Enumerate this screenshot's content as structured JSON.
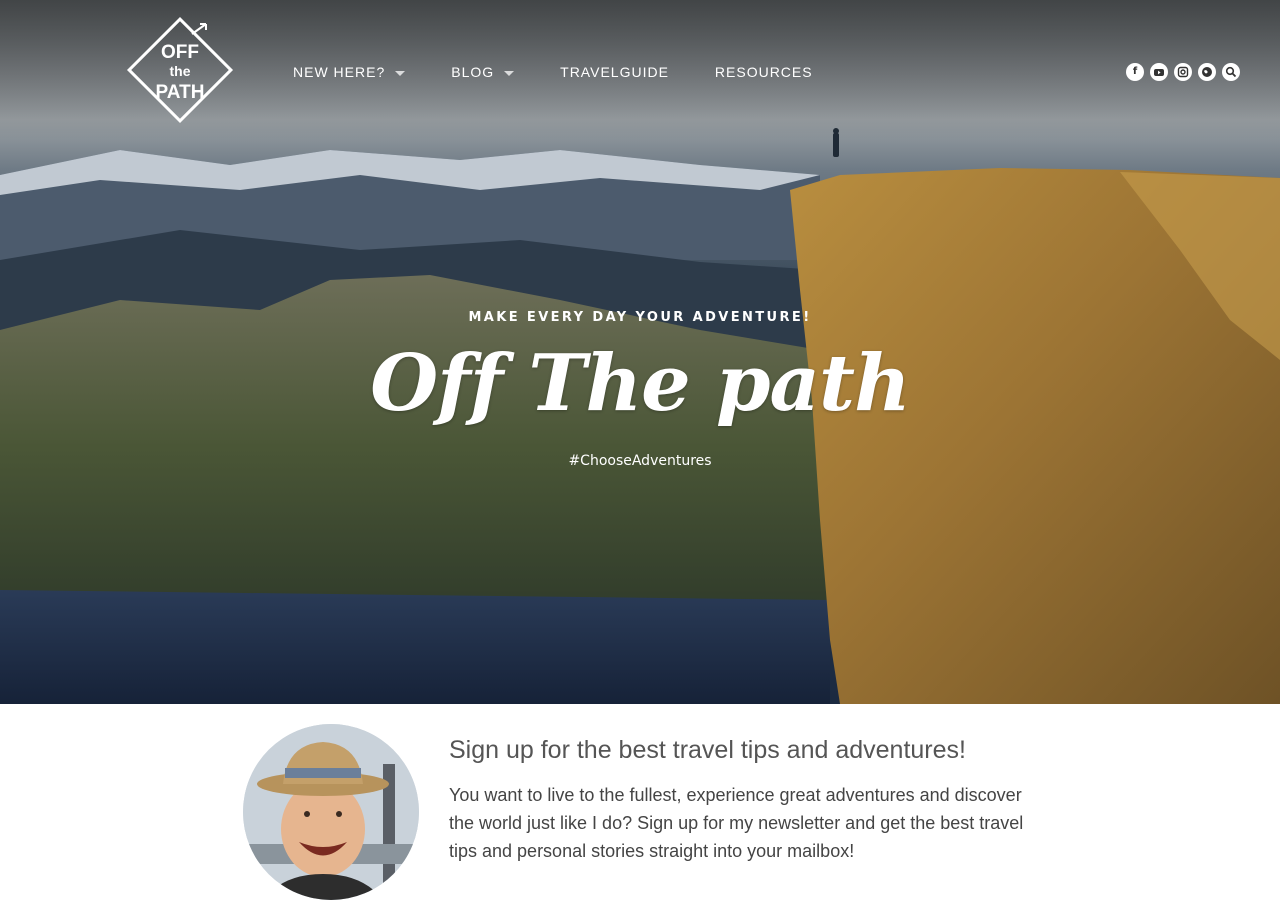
{
  "header": {
    "logo_text": [
      "OFF",
      "the",
      "PATH"
    ],
    "nav": [
      {
        "label": "NEW HERE?",
        "dropdown": true
      },
      {
        "label": "BLOG",
        "dropdown": true
      },
      {
        "label": "TRAVELGUIDE",
        "dropdown": false
      },
      {
        "label": "RESOURCES",
        "dropdown": false
      }
    ],
    "social_icons": [
      "facebook-icon",
      "youtube-icon",
      "instagram-icon",
      "globe-icon",
      "search-icon"
    ]
  },
  "hero": {
    "tagline": "MAKE EVERY DAY YOUR ADVENTURE!",
    "brand": "Off The path",
    "hashtag": "#ChooseAdventures"
  },
  "signup": {
    "title": "Sign up for the best travel tips and adventures!",
    "text": "You want to live to the fullest, experience great adventures and discover the world just like I do? Sign up for my newsletter and get the best travel tips and personal stories straight into your mailbox!"
  },
  "colors": {
    "nav_text": "#ffffff",
    "title_text": "#555555",
    "body_text": "#444444"
  }
}
